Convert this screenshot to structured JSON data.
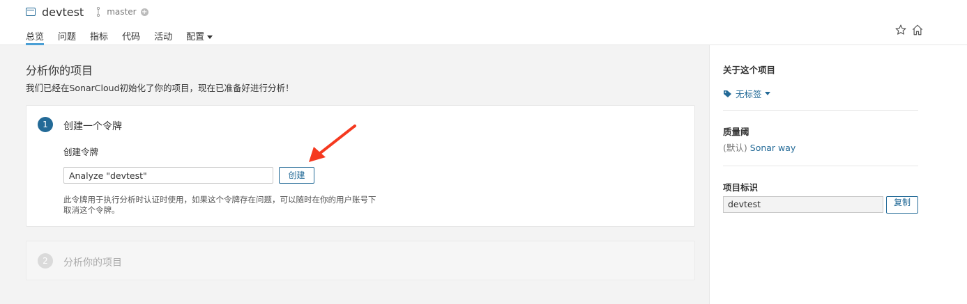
{
  "header": {
    "project_name": "devtest",
    "branch": "master",
    "tabs": [
      {
        "label": "总览",
        "active": true
      },
      {
        "label": "问题"
      },
      {
        "label": "指标"
      },
      {
        "label": "代码"
      },
      {
        "label": "活动"
      },
      {
        "label": "配置"
      }
    ]
  },
  "main": {
    "title": "分析你的项目",
    "description": "我们已经在SonarCloud初始化了你的项目，现在已准备好进行分析！",
    "step1": {
      "number": "1",
      "title": "创建一个令牌",
      "sub_label": "创建令牌",
      "token_value": "Analyze \"devtest\"",
      "create_button": "创建",
      "note": "此令牌用于执行分析时认证时使用，如果这个令牌存在问题，可以随时在你的用户账号下取消这个令牌。"
    },
    "step2": {
      "number": "2",
      "title": "分析你的项目"
    }
  },
  "sidebar": {
    "about_title": "关于这个项目",
    "tags_label": "无标签",
    "quality_gate_title": "质量阈",
    "quality_gate_default": "(默认)",
    "quality_gate_name": "Sonar way",
    "project_key_title": "项目标识",
    "project_key_value": "devtest",
    "copy_button": "复制"
  },
  "colors": {
    "accent": "#236a97",
    "tab_underline": "#4b9fd5",
    "arrow": "#f5391f"
  },
  "icons": {
    "project": "project-icon",
    "branch": "branch-icon",
    "add": "plus-circle-icon",
    "favorite": "star-icon",
    "home": "home-icon",
    "tag": "tag-icon"
  }
}
